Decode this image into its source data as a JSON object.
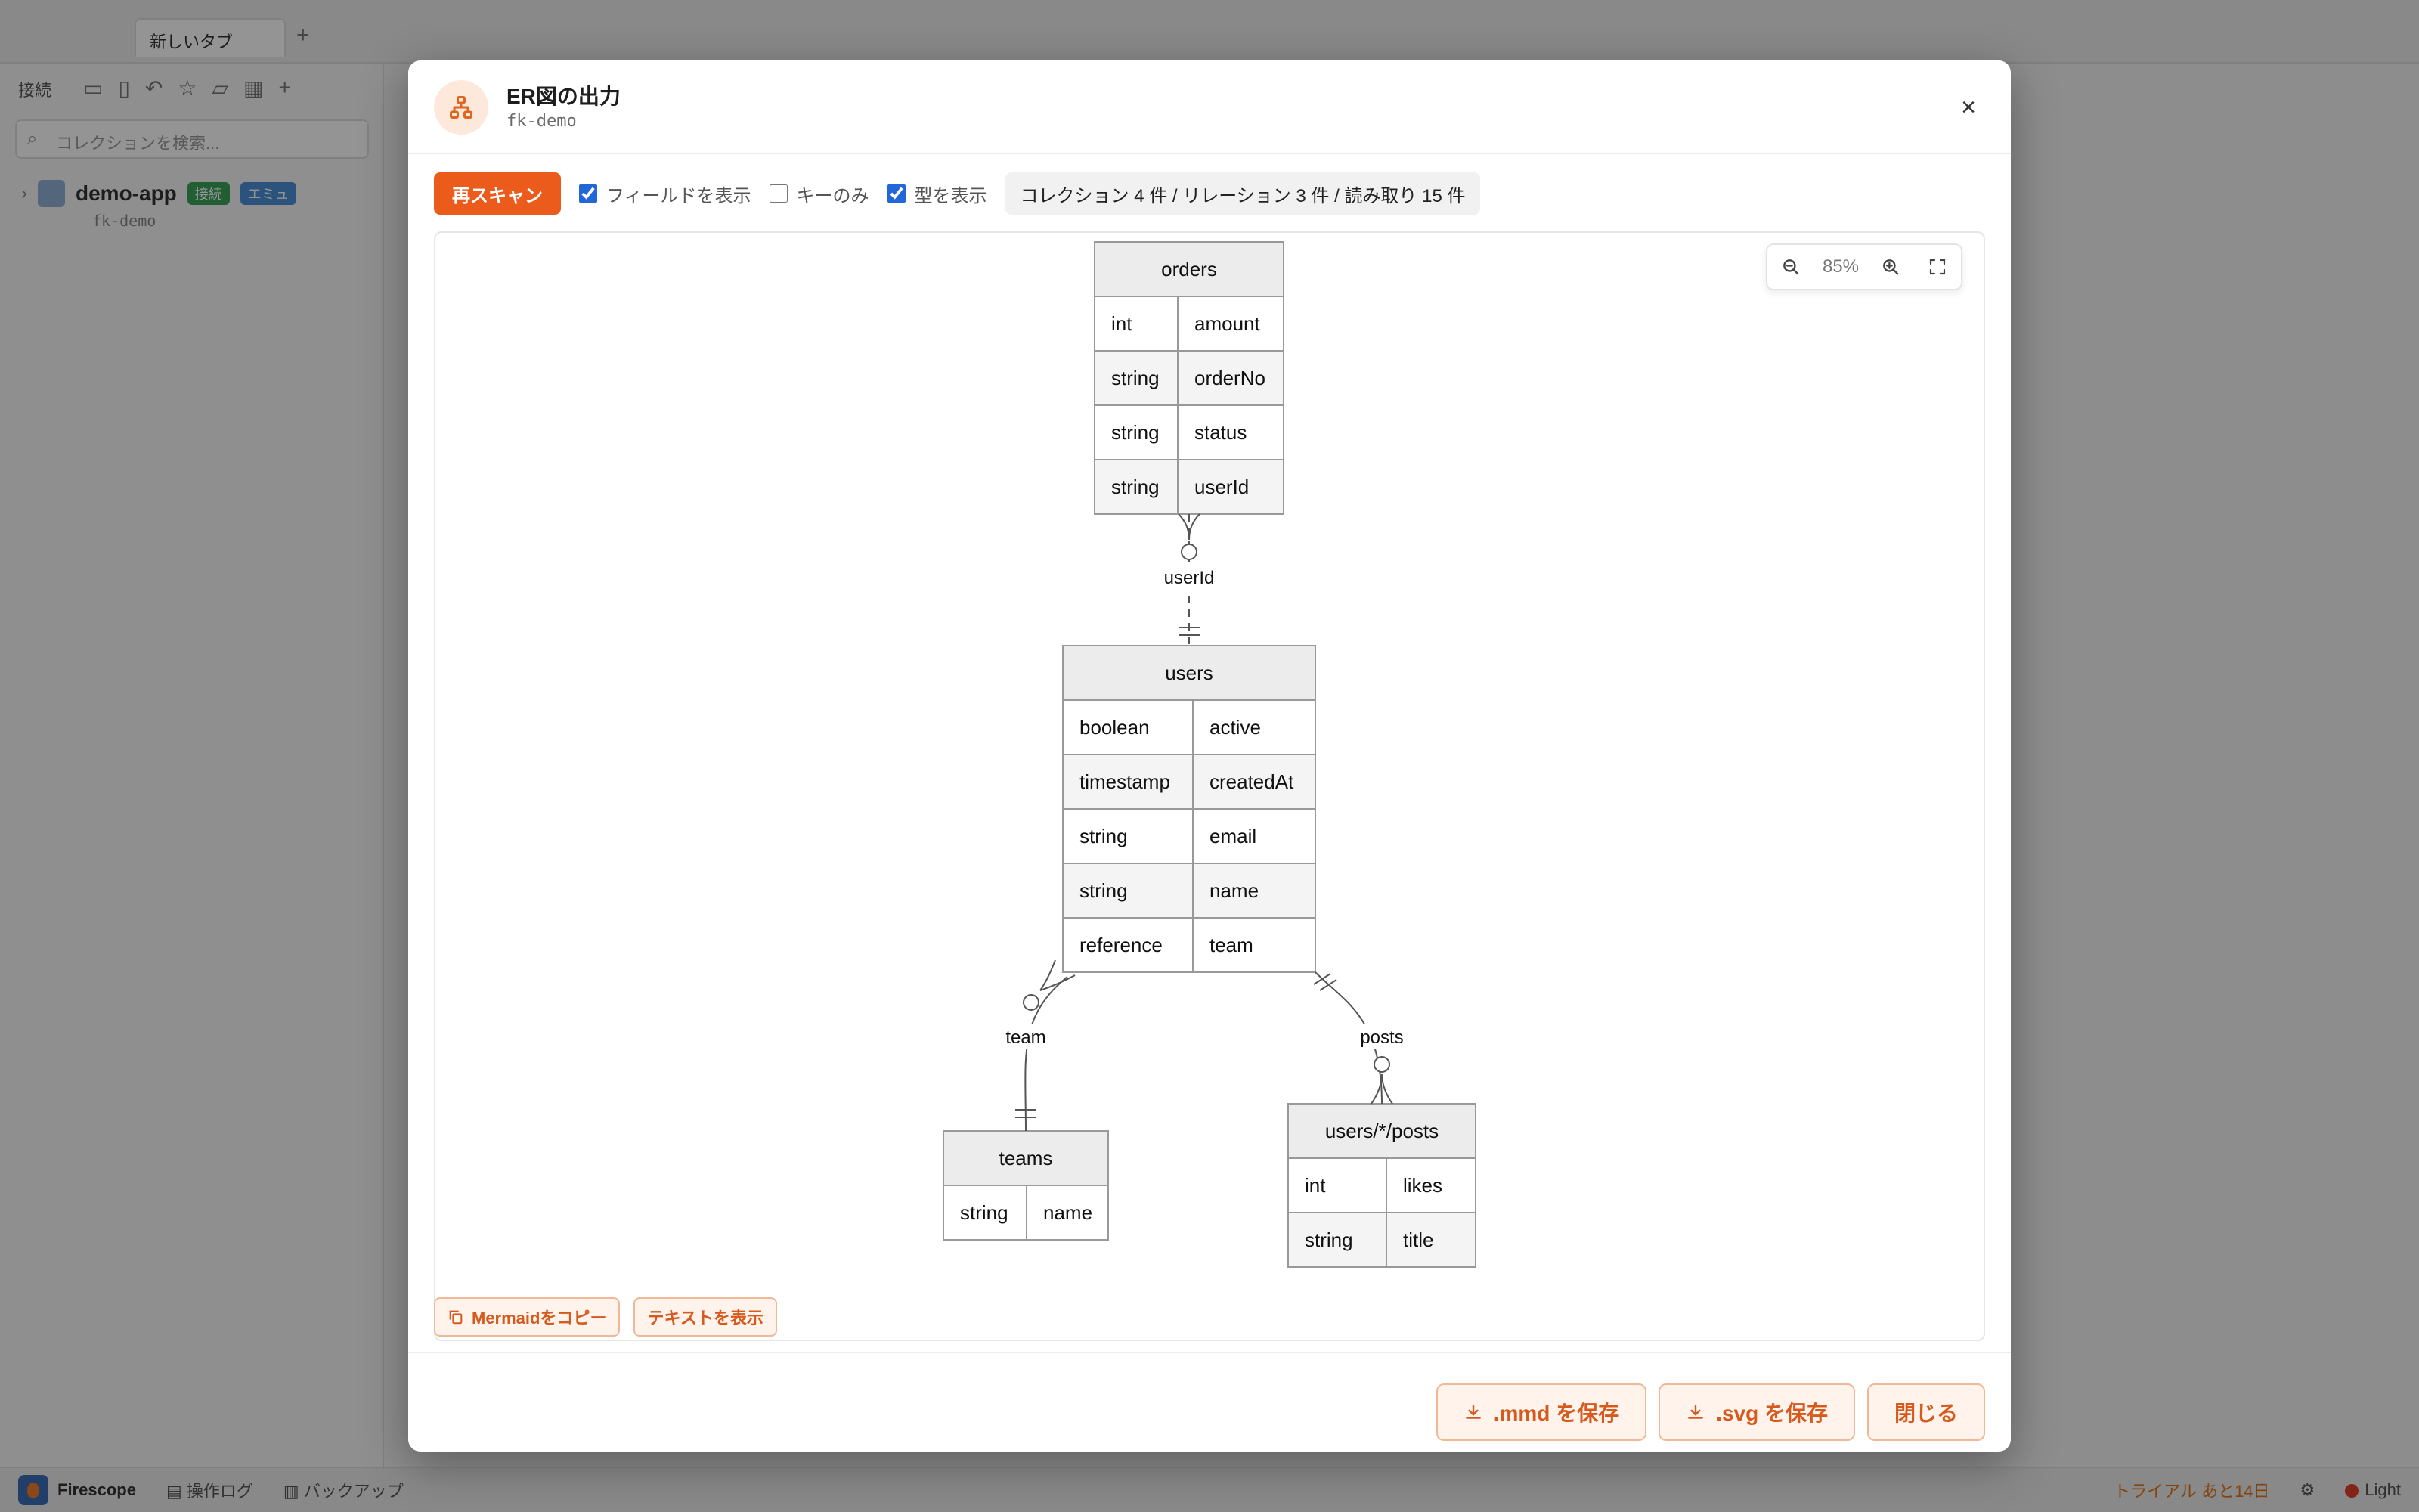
{
  "app": {
    "tab_label": "新しいタブ",
    "sidebar_title": "接続",
    "search_placeholder": "コレクションを検索...",
    "project_name": "demo-app",
    "project_badge_1": "接続",
    "project_badge_2": "エミュ",
    "project_id": "fk-demo",
    "status_app_name": "Firescope",
    "status_log": "操作ログ",
    "status_backup": "バックアップ",
    "status_trial": "トライアル あと14日",
    "status_theme": "Light"
  },
  "modal": {
    "title": "ER図の出力",
    "subtitle": "fk-demo",
    "rescan_label": "再スキャン",
    "show_fields_label": "フィールドを表示",
    "show_fields_checked": true,
    "keys_only_label": "キーのみ",
    "keys_only_checked": false,
    "show_types_label": "型を表示",
    "show_types_checked": true,
    "summary": "コレクション 4 件 / リレーション 3 件 / 読み取り 15 件",
    "zoom_level": "85%",
    "copy_mermaid_label": "Mermaidをコピー",
    "show_text_label": "テキストを表示",
    "save_mmd_label": ".mmd を保存",
    "save_svg_label": ".svg を保存",
    "close_label": "閉じる"
  },
  "diagram": {
    "entities": [
      {
        "name": "orders",
        "fields": [
          {
            "type": "int",
            "name": "amount"
          },
          {
            "type": "string",
            "name": "orderNo"
          },
          {
            "type": "string",
            "name": "status"
          },
          {
            "type": "string",
            "name": "userId"
          }
        ]
      },
      {
        "name": "users",
        "fields": [
          {
            "type": "boolean",
            "name": "active"
          },
          {
            "type": "timestamp",
            "name": "createdAt"
          },
          {
            "type": "string",
            "name": "email"
          },
          {
            "type": "string",
            "name": "name"
          },
          {
            "type": "reference",
            "name": "team"
          }
        ]
      },
      {
        "name": "teams",
        "fields": [
          {
            "type": "string",
            "name": "name"
          }
        ]
      },
      {
        "name": "users/*/posts",
        "fields": [
          {
            "type": "int",
            "name": "likes"
          },
          {
            "type": "string",
            "name": "title"
          }
        ]
      }
    ],
    "relations": [
      {
        "label": "userId",
        "from": "orders",
        "to": "users"
      },
      {
        "label": "team",
        "from": "users",
        "to": "teams"
      },
      {
        "label": "posts",
        "from": "users",
        "to": "users/*/posts"
      }
    ]
  }
}
